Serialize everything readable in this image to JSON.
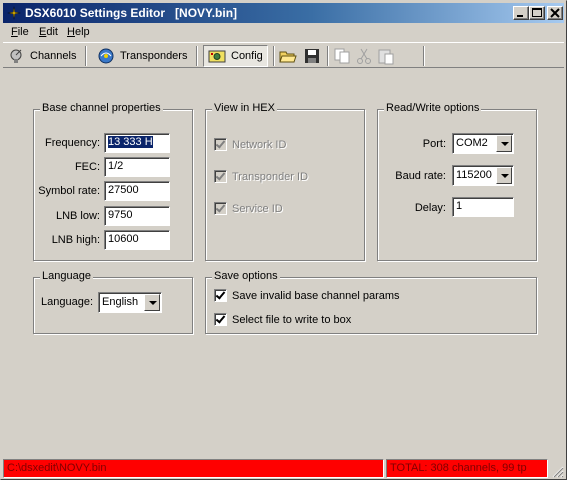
{
  "window": {
    "title": "DSX6010 Settings Editor   [NOVY.bin]",
    "minimize_label": "_",
    "maximize_label": "□",
    "close_label": "✕"
  },
  "menu": [
    {
      "label": "File",
      "accel": "F",
      "rest": "ile"
    },
    {
      "label": "Edit",
      "accel": "E",
      "rest": "dit"
    },
    {
      "label": "Help",
      "accel": "H",
      "rest": "elp"
    }
  ],
  "toolbar": {
    "channels_label": "Channels",
    "transponders_label": "Transponders",
    "config_label": "Config",
    "active": "Config"
  },
  "base_channel": {
    "title": "Base channel properties",
    "frequency_label": "Frequency:",
    "frequency_value": "13 333 H",
    "fec_label": "FEC:",
    "fec_value": "1/2",
    "symbol_rate_label": "Symbol rate:",
    "symbol_rate_value": "27500",
    "lnb_low_label": "LNB low:",
    "lnb_low_value": "9750",
    "lnb_high_label": "LNB high:",
    "lnb_high_value": "10600"
  },
  "view_hex": {
    "title": "View in HEX",
    "network_id": "Network ID",
    "transponder_id": "Transponder ID",
    "service_id": "Service ID"
  },
  "read_write": {
    "title": "Read/Write options",
    "port_label": "Port:",
    "port_value": "COM2",
    "baud_label": "Baud rate:",
    "baud_value": "115200",
    "delay_label": "Delay:",
    "delay_value": "1"
  },
  "language": {
    "title": "Language",
    "label": "Language:",
    "value": "English"
  },
  "save_options": {
    "title": "Save options",
    "option1": "Save invalid base channel params",
    "option2": "Select file to write to box"
  },
  "status": {
    "path": "C:\\dsxedit\\NOVY.bin",
    "total": "TOTAL: 308 channels, 99 tp"
  },
  "colors": {
    "title_start": "#0a246a",
    "title_end": "#a6caf0",
    "status_bg": "#ff0000",
    "face": "#d4d0c8"
  }
}
